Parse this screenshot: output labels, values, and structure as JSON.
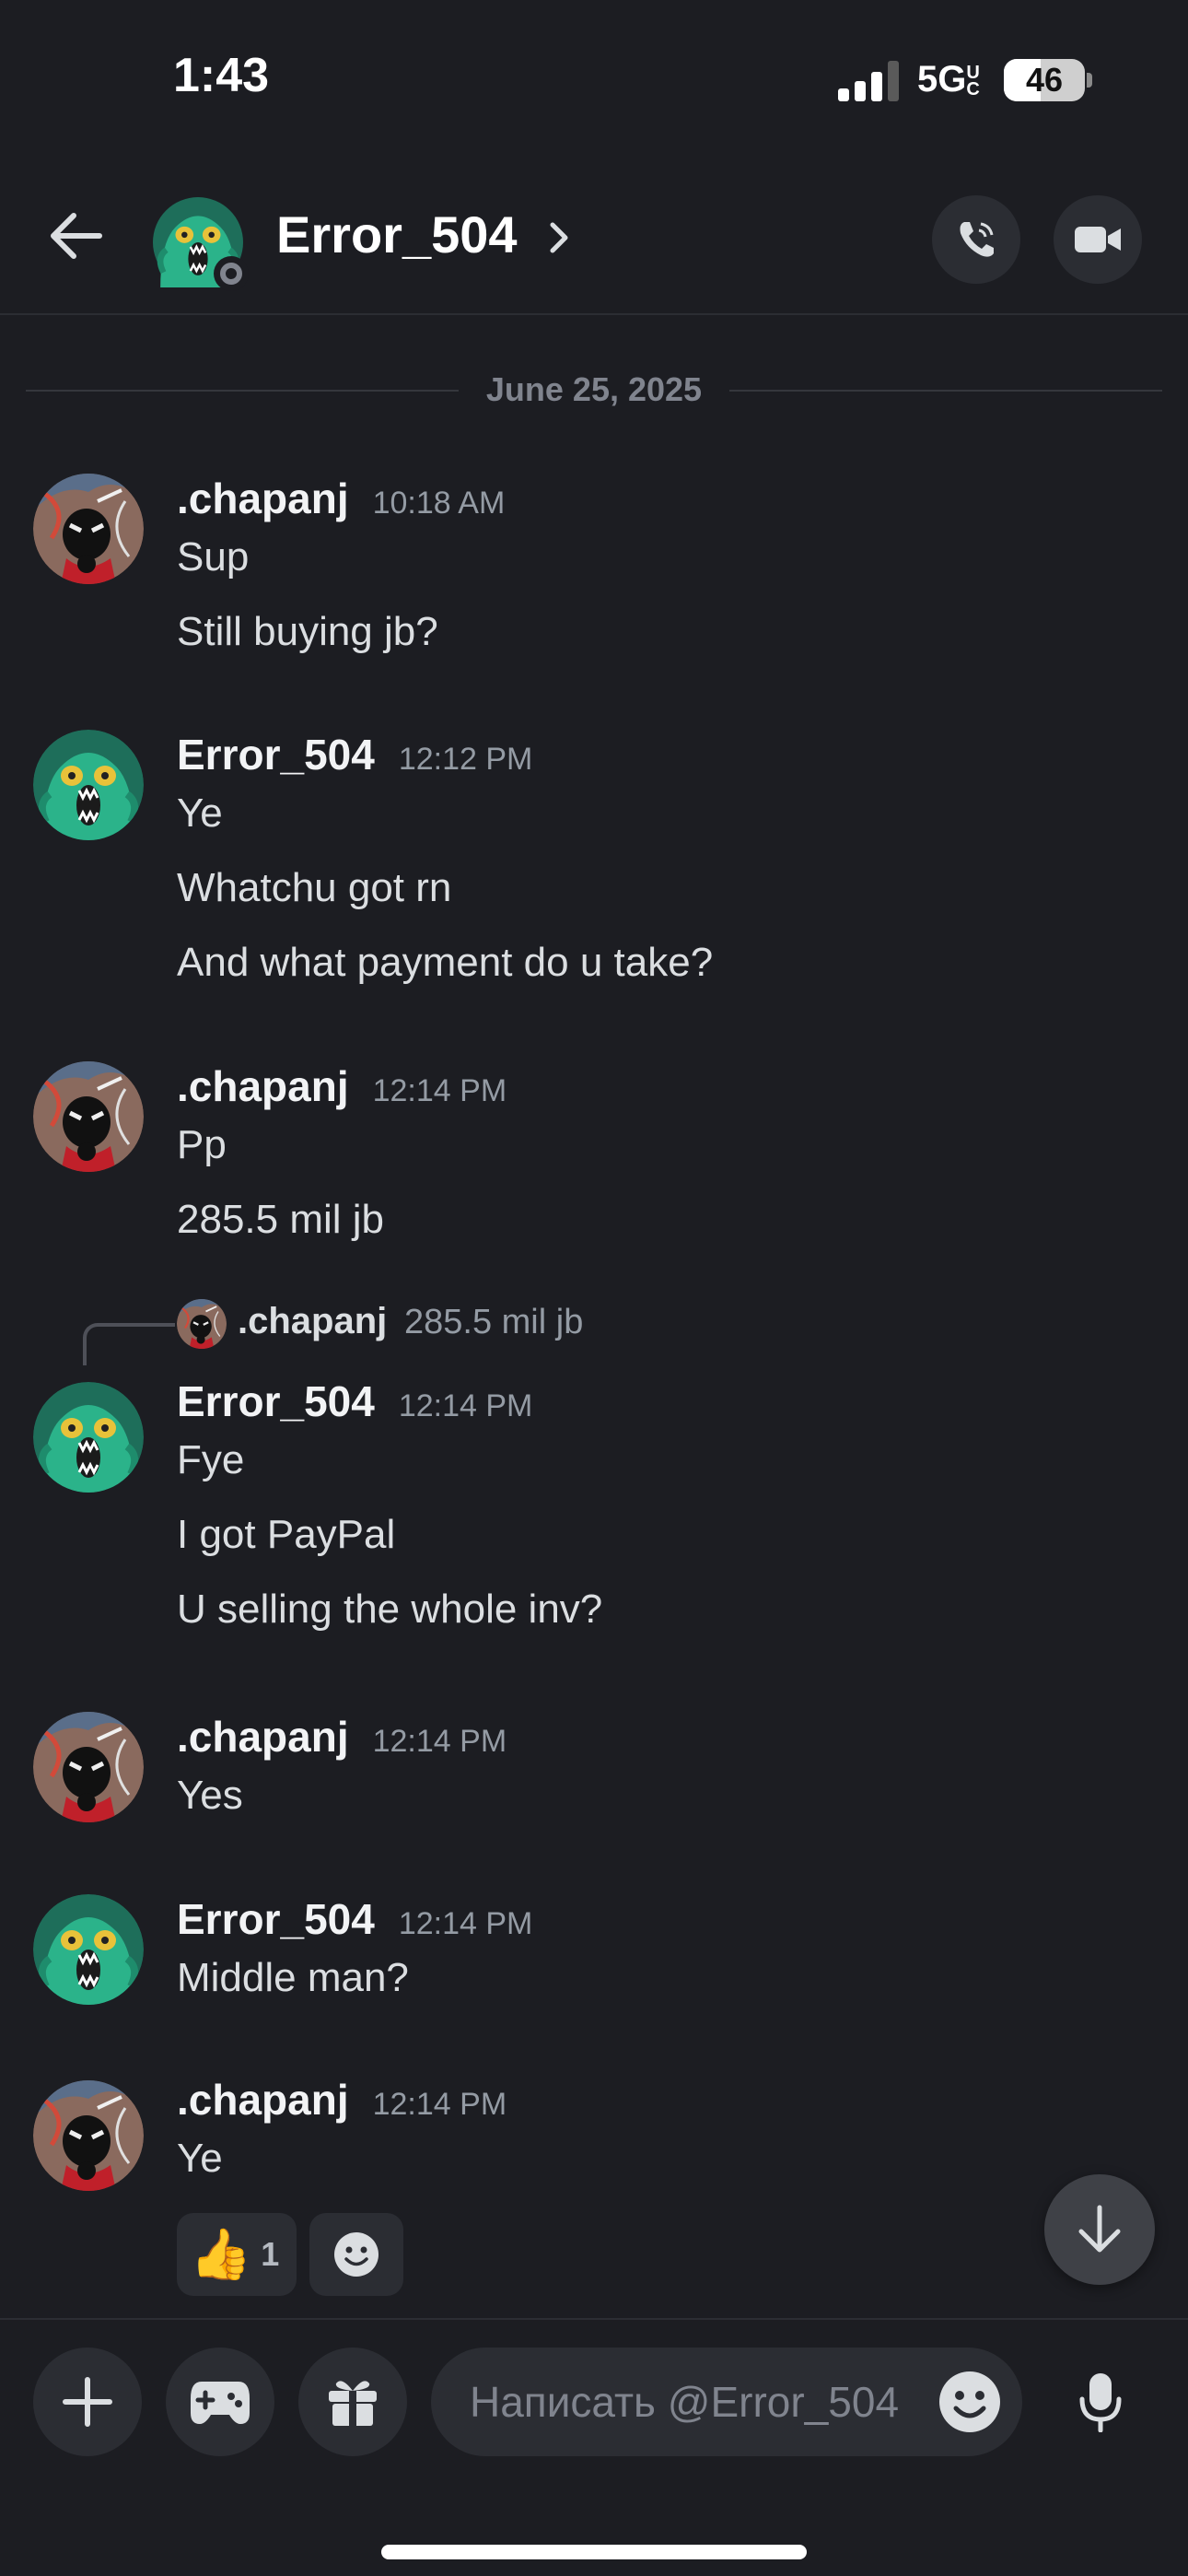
{
  "status_bar": {
    "time": "1:43",
    "network": "5G",
    "network_sub": "UC",
    "battery": "46",
    "battery_level_percent": 46
  },
  "header": {
    "contact_name": "Error_504",
    "status": "offline",
    "icons": [
      "back-arrow-icon",
      "chevron-right-icon",
      "phone-call-icon",
      "video-camera-icon"
    ]
  },
  "date_divider": "June 25, 2025",
  "messages": [
    {
      "author": ".chapanj",
      "time": "10:18 AM",
      "lines": [
        "Sup",
        "Still buying jb?"
      ]
    },
    {
      "author": "Error_504",
      "time": "12:12 PM",
      "lines": [
        "Ye",
        "Whatchu got rn",
        "And what payment do u take?"
      ]
    },
    {
      "author": ".chapanj",
      "time": "12:14 PM",
      "lines": [
        "Pp",
        "285.5 mil jb"
      ]
    },
    {
      "author": "Error_504",
      "time": "12:14 PM",
      "reply_to": {
        "author": ".chapanj",
        "text": "285.5 mil jb"
      },
      "lines": [
        "Fye",
        "I got PayPal",
        "U selling the whole inv?"
      ]
    },
    {
      "author": ".chapanj",
      "time": "12:14 PM",
      "lines": [
        "Yes"
      ]
    },
    {
      "author": "Error_504",
      "time": "12:14 PM",
      "lines": [
        "Middle man?"
      ]
    },
    {
      "author": ".chapanj",
      "time": "12:14 PM",
      "lines": [
        "Ye"
      ],
      "reactions": [
        {
          "emoji": "👍",
          "count": "1"
        }
      ]
    }
  ],
  "composer": {
    "placeholder": "Написать @Error_504",
    "icons": [
      "plus-icon",
      "gamepad-icon",
      "gift-icon",
      "emoji-icon",
      "microphone-icon"
    ]
  },
  "colors": {
    "background": "#1c1d22",
    "surface": "#2b2d33",
    "text": "#dbdee1",
    "muted": "#949ba4",
    "author": "#f2f3f5",
    "avatar_green": "#2bb38a"
  }
}
